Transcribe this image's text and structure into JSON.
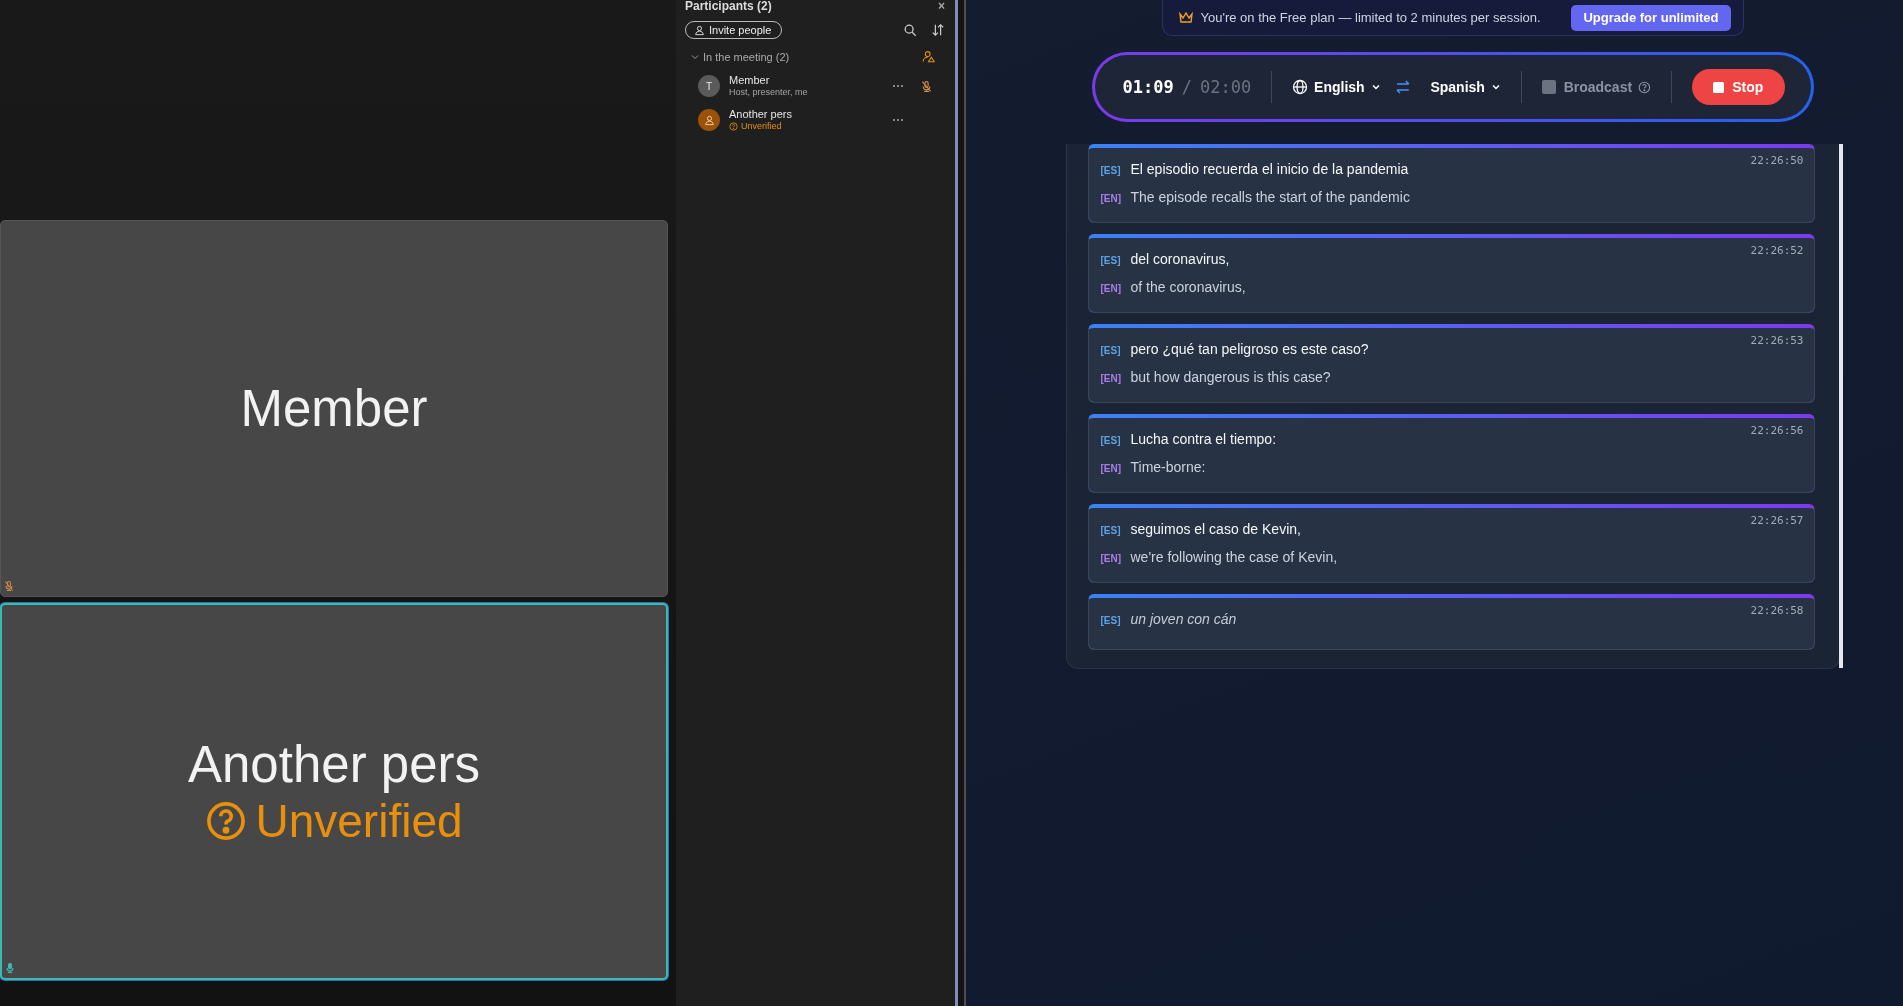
{
  "video_tiles": [
    {
      "name": "Member",
      "muted": true,
      "active": false
    },
    {
      "name": "Another pers",
      "status": "Unverified",
      "muted": false,
      "active": true
    }
  ],
  "participants_panel": {
    "title": "Participants (2)",
    "close_label": "×",
    "invite_label": "Invite people",
    "section": {
      "label": "In the meeting (2)",
      "expanded": true
    },
    "people": [
      {
        "name": "Member",
        "initial": "T",
        "subtitle": "Host, presenter, me",
        "kind": "host",
        "muted": true
      },
      {
        "name": "Another pers",
        "status": "Unverified",
        "kind": "guest"
      }
    ]
  },
  "plan_banner": {
    "message": "You're on the Free plan — limited to 2 minutes per session.",
    "upgrade_label": "Upgrade for unlimited"
  },
  "controls": {
    "elapsed": "01:09",
    "separator": "/",
    "limit": "02:00",
    "source_language": "English",
    "target_language": "Spanish",
    "broadcast": {
      "label": "Broadcast",
      "checked": false
    },
    "stop_label": "Stop"
  },
  "captions": [
    {
      "time": "22:26:50",
      "lines": [
        {
          "tag": "[ES]",
          "kind": "source",
          "text": "El episodio recuerda el inicio de la pandemia"
        },
        {
          "tag": "[EN]",
          "kind": "translation",
          "text": "The episode recalls the start of the pandemic"
        }
      ]
    },
    {
      "time": "22:26:52",
      "lines": [
        {
          "tag": "[ES]",
          "kind": "source",
          "text": "del coronavirus,"
        },
        {
          "tag": "[EN]",
          "kind": "translation",
          "text": "of the coronavirus,"
        }
      ]
    },
    {
      "time": "22:26:53",
      "lines": [
        {
          "tag": "[ES]",
          "kind": "source",
          "text": "pero ¿qué tan peligroso es este caso?"
        },
        {
          "tag": "[EN]",
          "kind": "translation",
          "text": "but how dangerous is this case?"
        }
      ]
    },
    {
      "time": "22:26:56",
      "lines": [
        {
          "tag": "[ES]",
          "kind": "source",
          "text": "Lucha contra el tiempo:"
        },
        {
          "tag": "[EN]",
          "kind": "translation",
          "text": "Time-borne:"
        }
      ]
    },
    {
      "time": "22:26:57",
      "lines": [
        {
          "tag": "[ES]",
          "kind": "source",
          "text": "seguimos el caso de Kevin,"
        },
        {
          "tag": "[EN]",
          "kind": "translation",
          "text": "we're following the case of Kevin,"
        }
      ]
    },
    {
      "time": "22:26:58",
      "lines": [
        {
          "tag": "[ES]",
          "kind": "interim",
          "text": "un joven con cán"
        }
      ]
    }
  ]
}
